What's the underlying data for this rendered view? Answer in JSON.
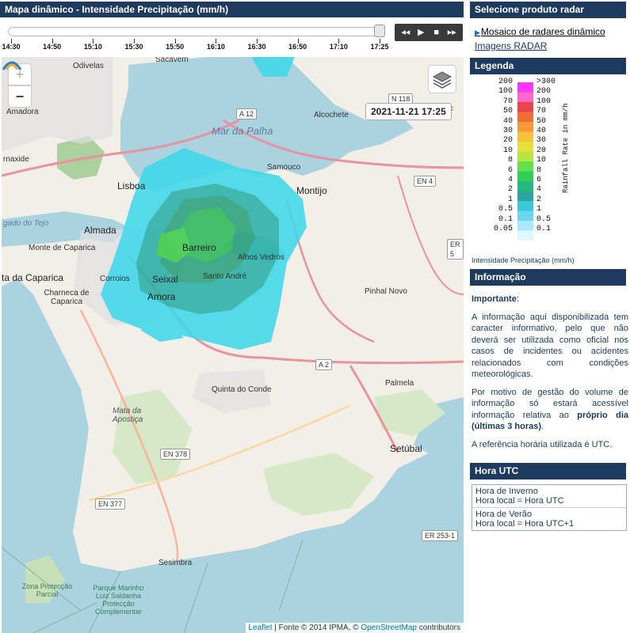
{
  "left_panel": {
    "title": "Mapa dinâmico - Intensidade Precipitação (mm/h)"
  },
  "timeline": {
    "labels": [
      "14:30",
      "14:50",
      "15:10",
      "15:30",
      "15:50",
      "16:10",
      "16:30",
      "16:50",
      "17:10",
      "17:25"
    ],
    "position": 1.0
  },
  "controls": {
    "icons": [
      "rewind-icon",
      "play-icon",
      "stop-icon",
      "fast-forward-icon"
    ],
    "glyphs": [
      "◂◂",
      "▶",
      "■",
      "▸▸"
    ]
  },
  "map": {
    "zoom_in": "+",
    "zoom_out": "−",
    "timestamp": "2021-11-21 17:25",
    "places": {
      "odivelas": "Odivelas",
      "sacavem": "Sacavém",
      "amadora": "Amadora",
      "rnaxide": "rnaxide",
      "lisboa": "Lisboa",
      "mar_palha": "Mar da Palha",
      "alcochete": "Alcochete",
      "samouco": "Samouco",
      "montijo": "Montijo",
      "almada": "Almada",
      "monte_caparica": "Monte de Caparica",
      "costa_caparica": "ta da Caparica",
      "barreiro": "Barreiro",
      "alhos_vedros": "Alhos Vedros",
      "seixal": "Seixal",
      "santo_andre": "Santo André",
      "corroios": "Corroios",
      "charneca": "Charneca de Caparica",
      "amora": "Amora",
      "pinhal_novo": "Pinhal Novo",
      "palmela": "Palmela",
      "quinta_conde": "Quinta do Conde",
      "mata_apostica": "Mata da Apostiça",
      "setubal": "Setúbal",
      "sesimbra": "Sesimbra",
      "parque_marinho": "Parque Marinho Luiz Saldanha",
      "alc": "Alc",
      "gado_tejo": "gado do Tejo",
      "zona_proteccao": "Zona Protecção Parcial",
      "parque_marinho2": "Parque Marinho Luiz Saldanha Protecção Complementar"
    },
    "roads": {
      "a12": "A 12",
      "n118": "N 118",
      "en4": "EN 4",
      "er5": "ER 5",
      "a2": "A 2",
      "en378": "EN 378",
      "en377": "EN 377",
      "er253": "ER 253-1"
    },
    "attribution": {
      "leaflet": "Leaflet",
      "middle": " | Fonte © 2014 IPMA, © ",
      "osm": "OpenStreetMap",
      "end": " contributors"
    }
  },
  "right_panel": {
    "product_header": "Selecione produto radar",
    "link_dynamic": "Mosaico de radares dinâmico",
    "link_images": "Imagens RADAR",
    "legend_header": "Legenda",
    "legend_left": [
      "200",
      "100",
      "70",
      "50",
      "40",
      "30",
      "20",
      "10",
      "8",
      "6",
      "4",
      "2",
      "1",
      "0.5",
      "0.1",
      "0.05"
    ],
    "legend_right": [
      ">300",
      "200",
      "100",
      "70",
      "50",
      "40",
      "30",
      "20",
      "10",
      "8",
      "6",
      "4",
      "2",
      "1",
      "0.5",
      "0.1"
    ],
    "legend_axis": "Rainfall Rate in mm/h",
    "legend_caption": "Intensidade Precipitação (mm/h)",
    "legend_colors": [
      "#ff33ff",
      "#ff66cc",
      "#e8444a",
      "#f06a3a",
      "#f59a3a",
      "#f7c23a",
      "#e8e03a",
      "#b8e640",
      "#64e04a",
      "#2fd058",
      "#27b880",
      "#2aa8a0",
      "#38c8d8",
      "#6ad8f0",
      "#a8e8f8",
      "#dff6ff"
    ],
    "info_header": "Informação",
    "info_important": "Importante",
    "info_colon": ":",
    "info_p1": "A informação aqui disponibilizada tem caracter informativo, pelo que não deverá ser utilizada como oficial nos casos de incidentes ou acidentes relacionados com condições meteorológicas.",
    "info_p2a": "Por motivo de gestão do volume de informação só estará acessível informação relativa ao ",
    "info_p2b": "próprio dia (últimas 3 horas)",
    "info_p2c": ".",
    "info_p3": "A referência horária utilizada é UTC.",
    "utc_header": "Hora UTC",
    "utc_winter_title": "Hora de Inverno",
    "utc_winter_value": "Hora local = Hora UTC",
    "utc_summer_title": "Hora de Verão",
    "utc_summer_value": "Hora local = Hora UTC+1"
  }
}
